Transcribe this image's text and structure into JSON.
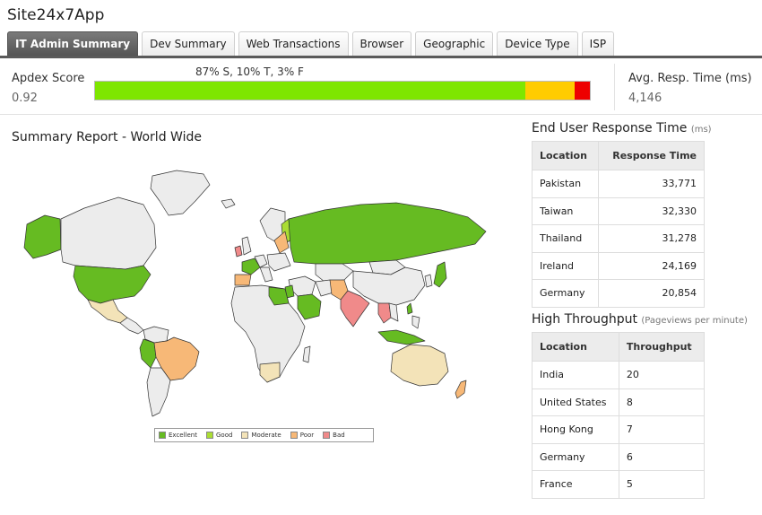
{
  "app": {
    "title": "Site24x7App"
  },
  "tabs": [
    {
      "label": "IT Admin Summary",
      "active": true
    },
    {
      "label": "Dev Summary",
      "active": false
    },
    {
      "label": "Web Transactions",
      "active": false
    },
    {
      "label": "Browser",
      "active": false
    },
    {
      "label": "Geographic",
      "active": false
    },
    {
      "label": "Device Type",
      "active": false
    },
    {
      "label": "ISP",
      "active": false
    }
  ],
  "apdex": {
    "label": "Apdex Score",
    "value": "0.92",
    "summary": "87% S, 10% T, 3% F",
    "satisfied_pct": 87,
    "tolerating_pct": 10,
    "frustrated_pct": 3,
    "colors": {
      "satisfied": "#7ee600",
      "tolerating": "#ffcc00",
      "frustrated": "#ee0000"
    }
  },
  "avg_response": {
    "label": "Avg. Resp. Time (ms)",
    "value": "4,146"
  },
  "map": {
    "title": "Summary Report - World Wide",
    "legend": [
      {
        "label": "Excellent",
        "color": "#66bb22"
      },
      {
        "label": "Good",
        "color": "#aadd33"
      },
      {
        "label": "Moderate",
        "color": "#f3e3b8"
      },
      {
        "label": "Poor",
        "color": "#f7b877"
      },
      {
        "label": "Bad",
        "color": "#f08a8a"
      }
    ]
  },
  "response_time": {
    "title": "End User Response Time",
    "unit": "(ms)",
    "columns": [
      "Location",
      "Response Time"
    ],
    "rows": [
      [
        "Pakistan",
        "33,771"
      ],
      [
        "Taiwan",
        "32,330"
      ],
      [
        "Thailand",
        "31,278"
      ],
      [
        "Ireland",
        "24,169"
      ],
      [
        "Germany",
        "20,854"
      ]
    ]
  },
  "throughput": {
    "title": "High Throughput",
    "unit": "(Pageviews per minute)",
    "columns": [
      "Location",
      "Throughput"
    ],
    "rows": [
      [
        "India",
        "20"
      ],
      [
        "United States",
        "8"
      ],
      [
        "Hong Kong",
        "7"
      ],
      [
        "Germany",
        "6"
      ],
      [
        "France",
        "5"
      ]
    ]
  }
}
